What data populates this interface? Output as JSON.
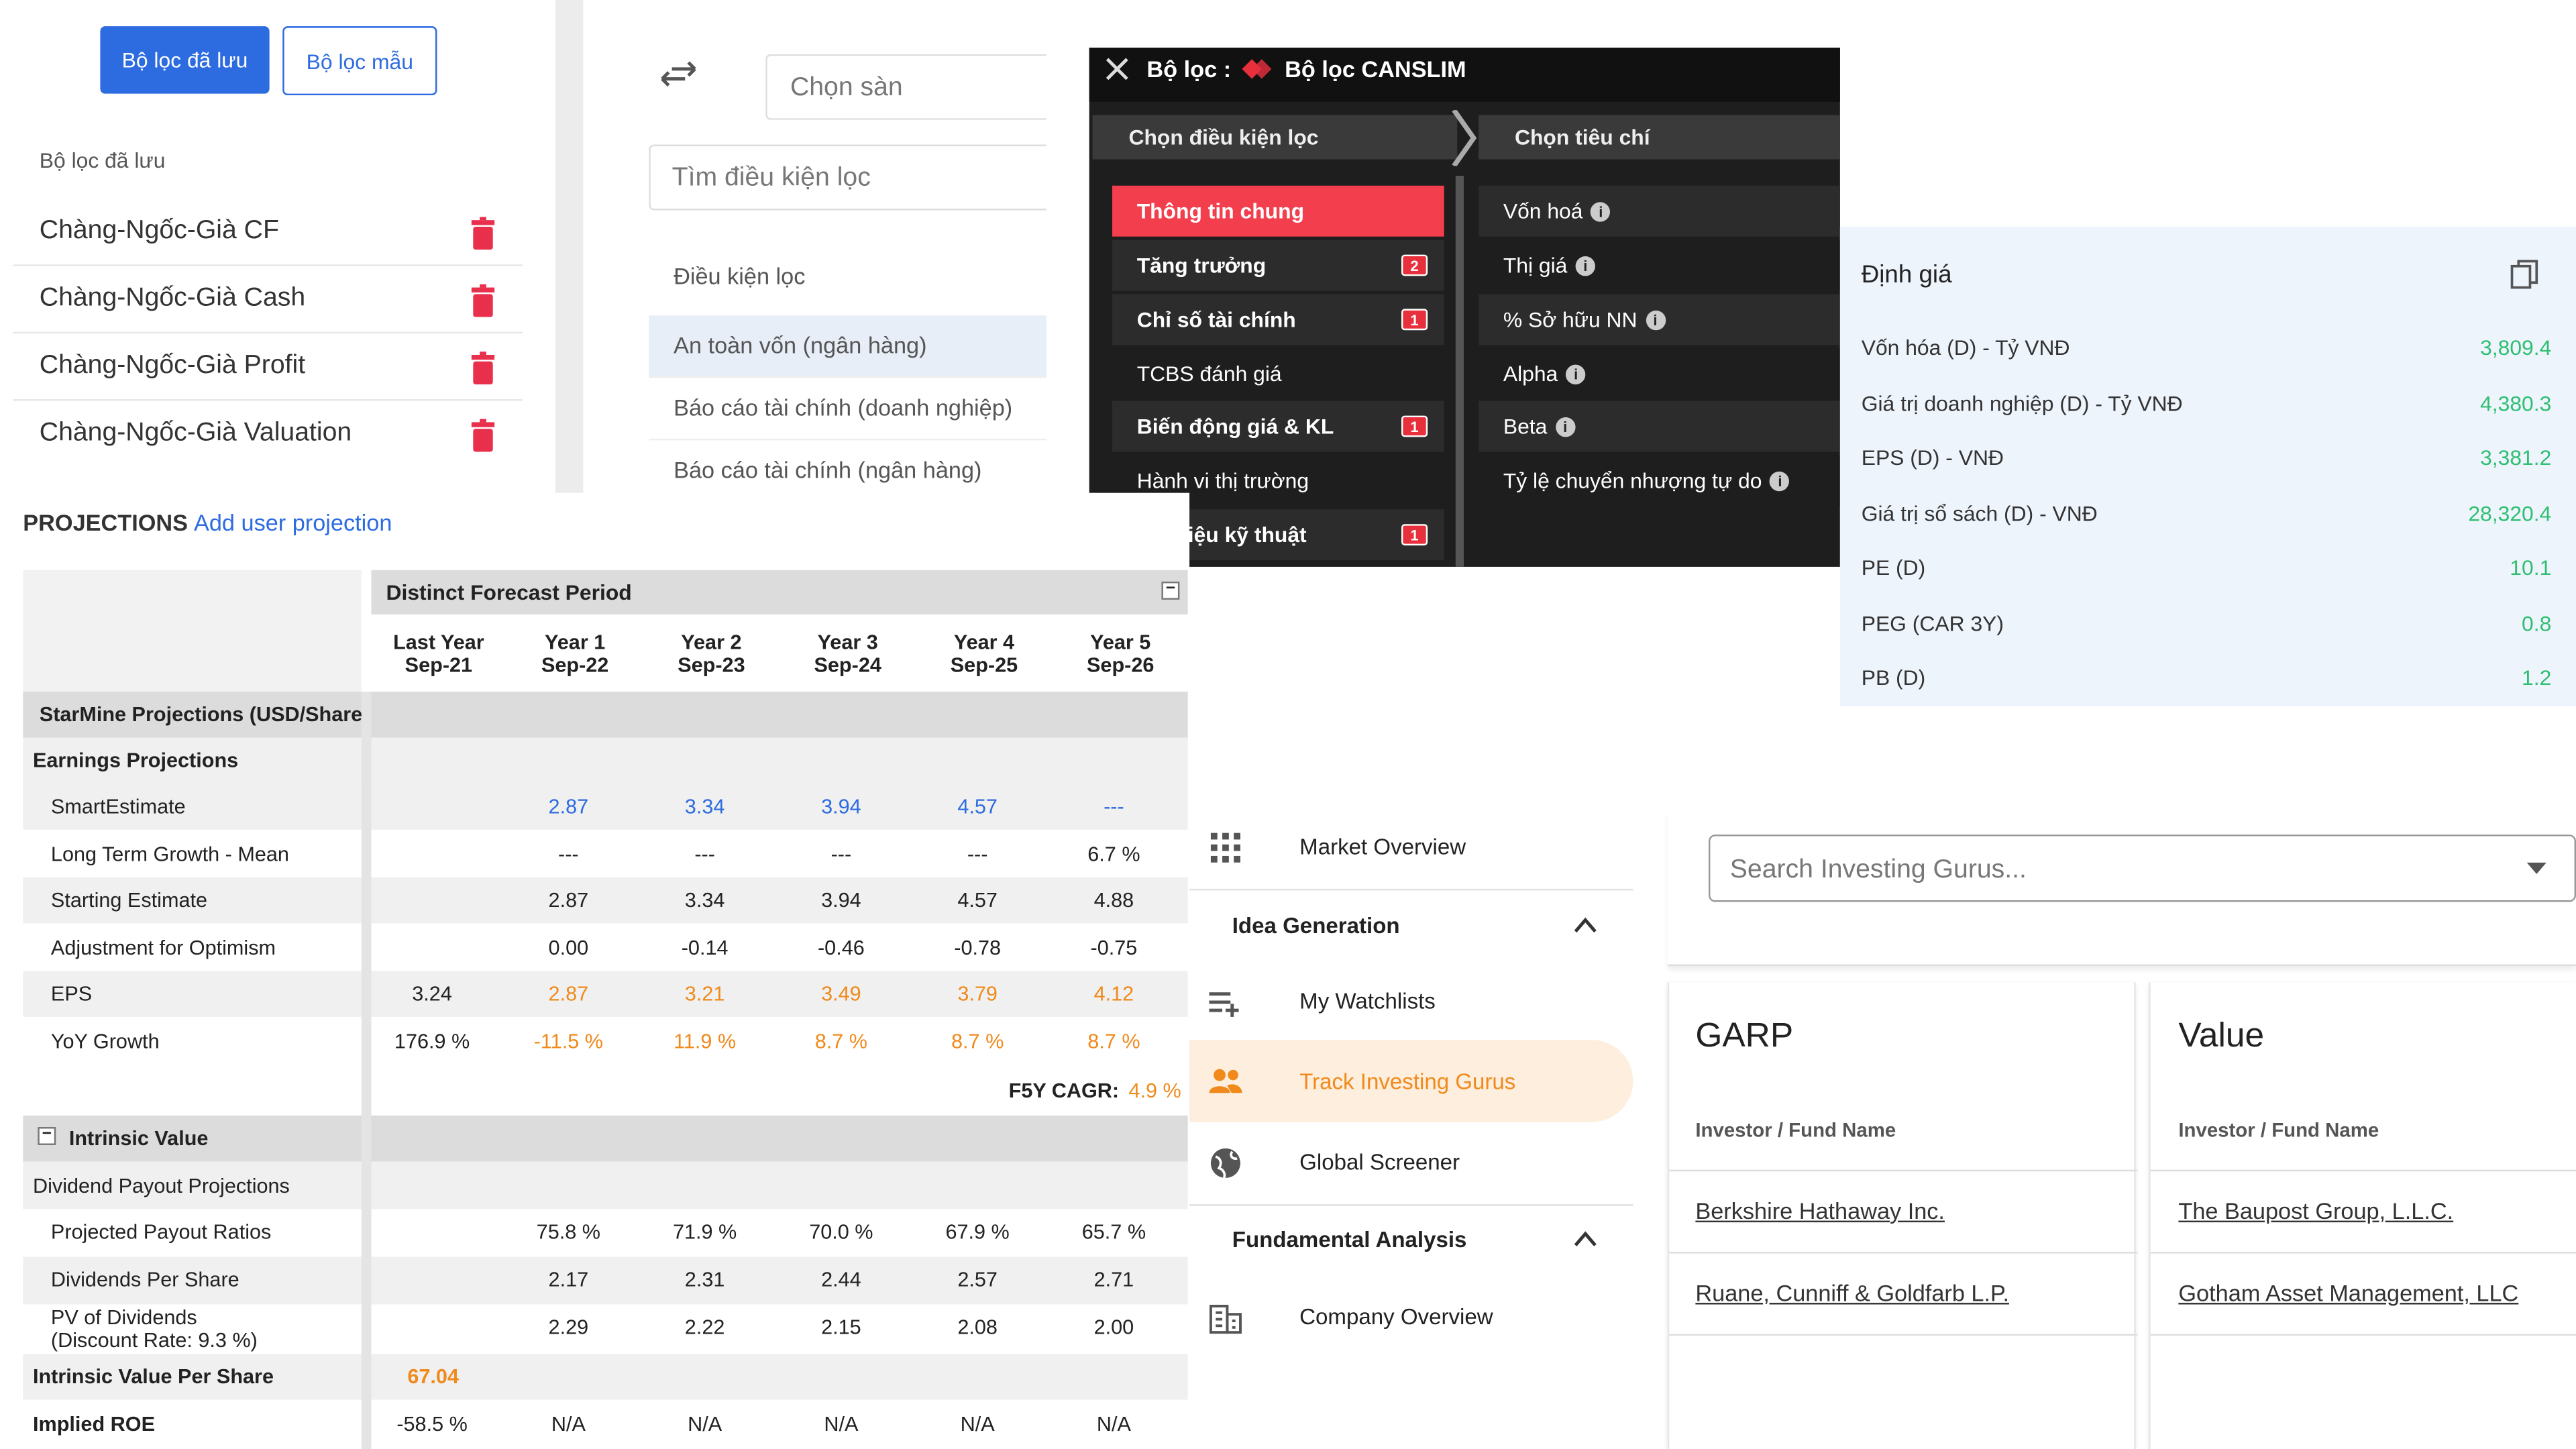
{
  "saved_filters": {
    "btn_saved": "Bộ lọc đã lưu",
    "btn_templates": "Bộ lọc mẫu",
    "section_label": "Bộ lọc đã lưu",
    "items": [
      "Chàng-Ngốc-Già CF",
      "Chàng-Ngốc-Già Cash",
      "Chàng-Ngốc-Già Profit",
      "Chàng-Ngốc-Già Valuation"
    ]
  },
  "filter_search": {
    "exchange_placeholder": "Chọn sàn",
    "search_placeholder": "Tìm điều kiện lọc",
    "section_label": "Điều kiện lọc",
    "items": [
      "An toàn vốn (ngân hàng)",
      "Báo cáo tài chính (doanh nghiệp)",
      "Báo cáo tài chính (ngân hàng)"
    ]
  },
  "canslim": {
    "title_prefix": "Bộ lọc :",
    "title_name": "Bộ lọc CANSLIM",
    "left_header": "Chọn điều kiện lọc",
    "right_header": "Chọn tiêu chí",
    "left_items": [
      {
        "label": "Thông tin chung",
        "badge": ""
      },
      {
        "label": "Tăng trưởng",
        "badge": "2"
      },
      {
        "label": "Chỉ số tài chính",
        "badge": "1"
      },
      {
        "label": "TCBS đánh giá",
        "badge": ""
      },
      {
        "label": "Biến động giá & KL",
        "badge": "1"
      },
      {
        "label": "Hành vi thị trường",
        "badge": ""
      },
      {
        "label": "Tín hiệu kỹ thuật",
        "badge": "1"
      }
    ],
    "right_items": [
      "Vốn hoá",
      "Thị giá",
      "% Sở hữu NN",
      "Alpha",
      "Beta",
      "Tỷ lệ chuyển nhượng tự do"
    ],
    "colors": {
      "active": "#f23e4d",
      "bg": "#1e1e1e"
    }
  },
  "valuation": {
    "title": "Định giá",
    "rows": [
      {
        "label": "Vốn hóa (D) - Tỷ VNĐ",
        "value": "3,809.4"
      },
      {
        "label": "Giá trị doanh nghiệp (D) - Tỷ VNĐ",
        "value": "4,380.3"
      },
      {
        "label": "EPS (D) - VNĐ",
        "value": "3,381.2"
      },
      {
        "label": "Giá trị sổ sách (D) - VNĐ",
        "value": "28,320.4"
      },
      {
        "label": "PE (D)",
        "value": "10.1"
      },
      {
        "label": "PEG (CAR 3Y)",
        "value": "0.8"
      },
      {
        "label": "PB (D)",
        "value": "1.2"
      }
    ]
  },
  "projections": {
    "title": "PROJECTIONS",
    "add_link": "Add user projection",
    "period_header": "Distinct Forecast Period",
    "columns": [
      {
        "top": "Last Year",
        "bottom": "Sep-21"
      },
      {
        "top": "Year 1",
        "bottom": "Sep-22"
      },
      {
        "top": "Year 2",
        "bottom": "Sep-23"
      },
      {
        "top": "Year 3",
        "bottom": "Sep-24"
      },
      {
        "top": "Year 4",
        "bottom": "Sep-25"
      },
      {
        "top": "Year 5",
        "bottom": "Sep-26"
      }
    ],
    "section_starmine": "StarMine Projections (USD/Share)",
    "section_earnings": "Earnings Projections",
    "rows": [
      {
        "label": "SmartEstimate",
        "cells": [
          "",
          "2.87",
          "3.34",
          "3.94",
          "4.57",
          "---"
        ],
        "style": "blue"
      },
      {
        "label": "Long Term Growth - Mean",
        "cells": [
          "",
          "---",
          "---",
          "---",
          "---",
          "6.7 %"
        ],
        "style": ""
      },
      {
        "label": "Starting Estimate",
        "cells": [
          "",
          "2.87",
          "3.34",
          "3.94",
          "4.57",
          "4.88"
        ],
        "style": ""
      },
      {
        "label": "Adjustment for Optimism",
        "cells": [
          "",
          "0.00",
          "-0.14",
          "-0.46",
          "-0.78",
          "-0.75"
        ],
        "style": ""
      },
      {
        "label": "EPS",
        "cells": [
          "3.24",
          "2.87",
          "3.21",
          "3.49",
          "3.79",
          "4.12"
        ],
        "style": "orange"
      },
      {
        "label": "YoY Growth",
        "cells": [
          "176.9 %",
          "-11.5 %",
          "11.9 %",
          "8.7 %",
          "8.7 %",
          "8.7 %"
        ],
        "style": "orange"
      }
    ],
    "cagr_label": "F5Y CAGR:",
    "cagr_value": "4.9 %",
    "section_intrinsic": "Intrinsic Value",
    "section_dividend": "Dividend Payout Projections",
    "div_rows": [
      {
        "label": "Projected Payout Ratios",
        "cells": [
          "",
          "75.8 %",
          "71.9 %",
          "70.0 %",
          "67.9 %",
          "65.7 %"
        ]
      },
      {
        "label": "Dividends Per Share",
        "cells": [
          "",
          "2.17",
          "2.31",
          "2.44",
          "2.57",
          "2.71"
        ]
      },
      {
        "label": "PV of Dividends",
        "label2": "(Discount Rate: 9.3 %)",
        "cells": [
          "",
          "2.29",
          "2.22",
          "2.15",
          "2.08",
          "2.00"
        ]
      }
    ],
    "ivps_label": "Intrinsic Value Per Share",
    "ivps_value": "67.04",
    "roe_label": "Implied ROE",
    "roe_cells": [
      "-58.5 %",
      "N/A",
      "N/A",
      "N/A",
      "N/A",
      "N/A"
    ]
  },
  "nav": {
    "items": [
      {
        "label": "Market Overview",
        "type": "item",
        "icon": "grid-icon"
      },
      {
        "label": "Idea Generation",
        "type": "section"
      },
      {
        "label": "My Watchlists",
        "type": "item",
        "icon": "list-add-icon"
      },
      {
        "label": "Track Investing Gurus",
        "type": "active",
        "icon": "people-icon"
      },
      {
        "label": "Global Screener",
        "type": "item",
        "icon": "globe-icon"
      },
      {
        "label": "Fundamental Analysis",
        "type": "section"
      },
      {
        "label": "Company Overview",
        "type": "item",
        "icon": "building-icon"
      }
    ]
  },
  "gurus": {
    "search_placeholder": "Search Investing Gurus...",
    "cards": [
      {
        "title": "GARP",
        "col_label": "Investor / Fund Name",
        "items": [
          "Berkshire Hathaway Inc.",
          "Ruane, Cunniff & Goldfarb L.P."
        ]
      },
      {
        "title": "Value",
        "col_label": "Investor / Fund Name",
        "items": [
          "The Baupost Group, L.L.C.",
          "Gotham Asset Management, LLC"
        ]
      }
    ]
  }
}
